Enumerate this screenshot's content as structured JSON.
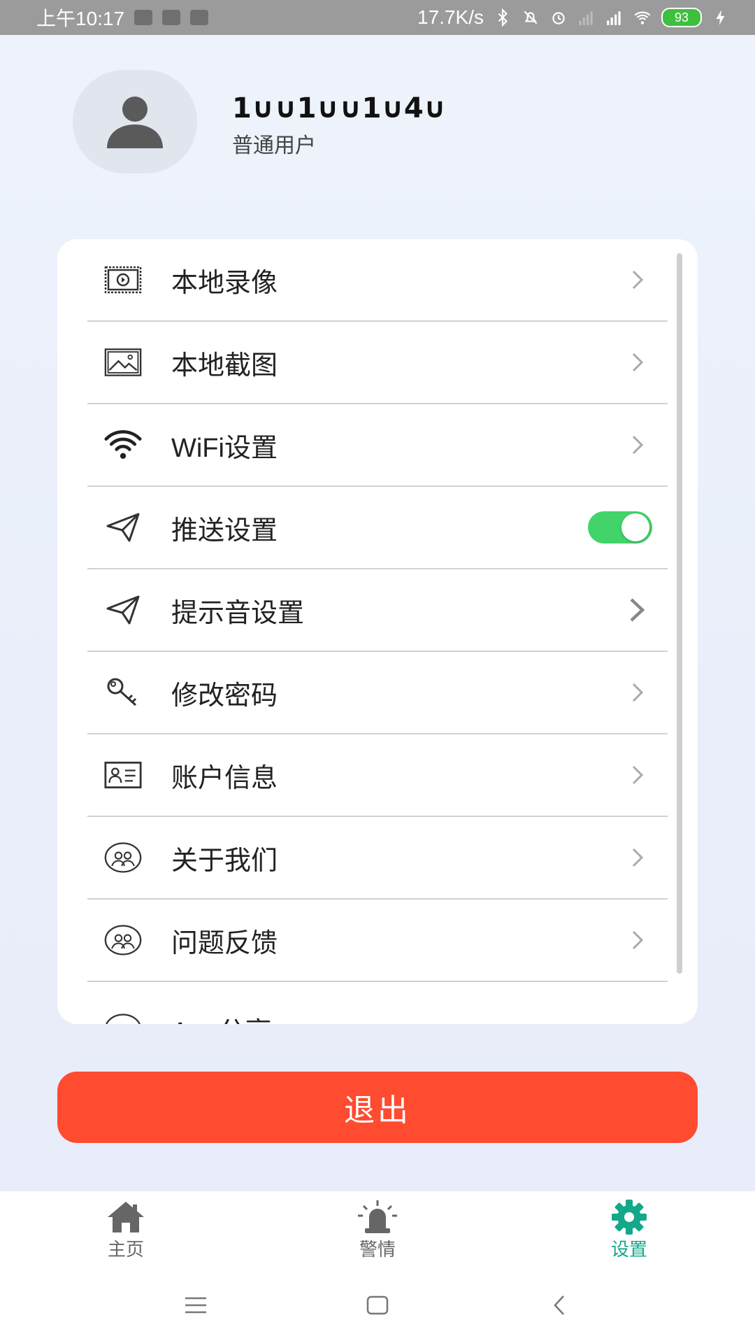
{
  "status_bar": {
    "time": "上午10:17",
    "net_speed": "17.7K/s",
    "battery": "93"
  },
  "profile": {
    "name": "1∪∪1∪∪1∪4∪",
    "role": "普通用户"
  },
  "menu": {
    "items": [
      {
        "label": "本地录像",
        "icon": "video-record-icon"
      },
      {
        "label": "本地截图",
        "icon": "image-icon"
      },
      {
        "label": "WiFi设置",
        "icon": "wifi-icon"
      },
      {
        "label": "推送设置",
        "icon": "send-icon",
        "toggle_on": true
      },
      {
        "label": "提示音设置",
        "icon": "send-icon"
      },
      {
        "label": "修改密码",
        "icon": "key-icon"
      },
      {
        "label": "账户信息",
        "icon": "id-card-icon"
      },
      {
        "label": "关于我们",
        "icon": "group-icon"
      },
      {
        "label": "问题反馈",
        "icon": "group-icon"
      },
      {
        "label": "App分享",
        "icon": "share-icon"
      }
    ]
  },
  "logout": {
    "label": "退出"
  },
  "bottom_nav": {
    "items": [
      {
        "label": "主页"
      },
      {
        "label": "警情"
      },
      {
        "label": "设置",
        "active": true
      }
    ]
  },
  "colors": {
    "accent": "#13a889",
    "logout": "#ff4b2f",
    "toggle": "#42d46a"
  }
}
